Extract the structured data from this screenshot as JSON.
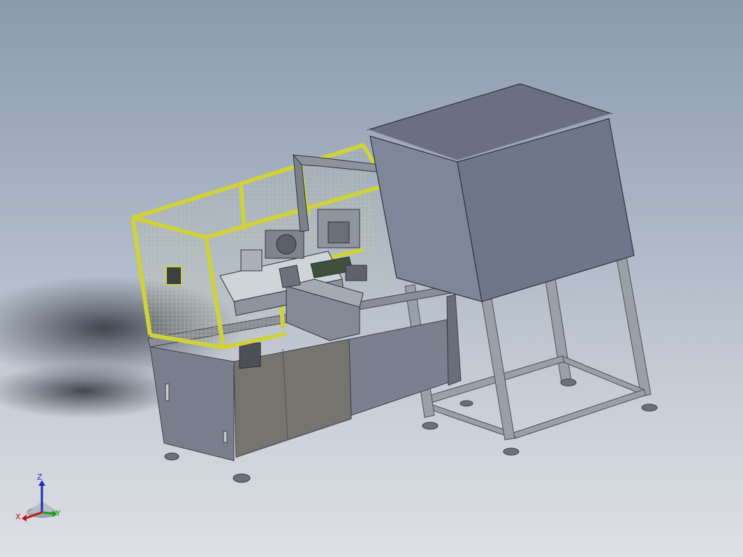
{
  "viewport": {
    "background_top": "#8c9ab0",
    "background_bottom": "#dde0e5"
  },
  "colors": {
    "frame_yellow": "#cfd23a",
    "cabinet_grey": "#7b7f8f",
    "hopper_grey": "#6e7588",
    "stand_grey": "#9aa0a8",
    "axis_x": "#c21414",
    "axis_y": "#14a414",
    "axis_z": "#1a2bb8"
  },
  "triad": {
    "x_label": "X",
    "y_label": "Y",
    "z_label": "Z"
  }
}
